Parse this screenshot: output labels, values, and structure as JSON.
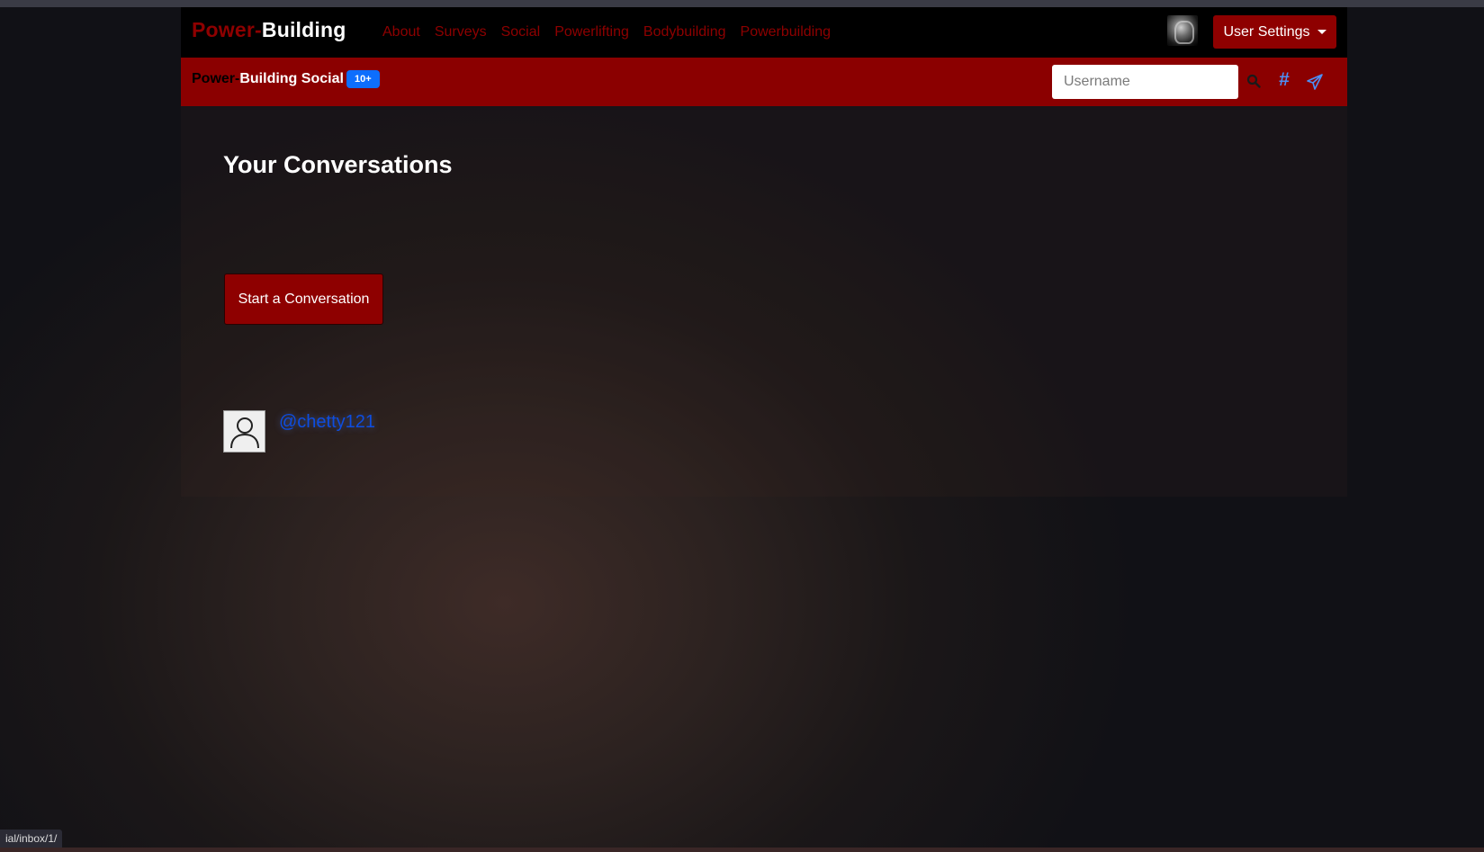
{
  "brand": {
    "part1": "Power-",
    "part2": "Building"
  },
  "nav": {
    "links": [
      "About",
      "Surveys",
      "Social",
      "Powerlifting",
      "Bodybuilding",
      "Powerbuilding"
    ]
  },
  "user_menu": {
    "label": "User Settings"
  },
  "social_bar": {
    "brand_part1": "Power-",
    "brand_part2": "Building Social",
    "badge": "10+",
    "search_placeholder": "Username",
    "hashtag_label": "#"
  },
  "main": {
    "title": "Your Conversations",
    "start_button": "Start a Conversation",
    "conversations": [
      {
        "username": "@chetty121"
      }
    ]
  },
  "status_bar": {
    "url": "ial/inbox/1/"
  },
  "colors": {
    "accent": "#8e0000",
    "badge": "#0d6efd",
    "link": "#0d4de0"
  }
}
